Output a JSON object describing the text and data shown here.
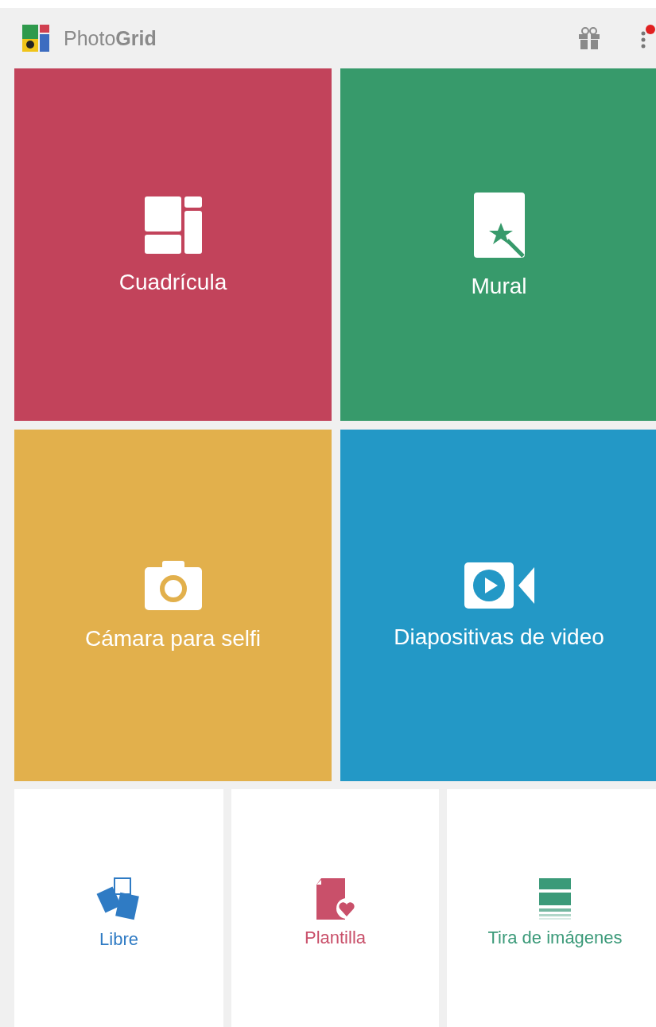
{
  "header": {
    "app_name": "Photo**Grid**",
    "notification_dot": true
  },
  "features": [
    {
      "kind": "grid",
      "label": "Cuadrícula",
      "color": "#c2435b"
    },
    {
      "kind": "mural",
      "label": "Mural",
      "color": "#379a6b"
    },
    {
      "kind": "camera",
      "label": "Cámara para selfi",
      "color": "#e2b04c"
    },
    {
      "kind": "video",
      "label": "Diapositivas de video",
      "color": "#2398c6"
    }
  ],
  "modes": [
    {
      "kind": "free",
      "label": "Libre",
      "color": "#2f7bc4"
    },
    {
      "kind": "template",
      "label": "Plantilla",
      "color": "#c9506a"
    },
    {
      "kind": "strip",
      "label": "Tira de imágenes",
      "color": "#3b9a79"
    }
  ]
}
